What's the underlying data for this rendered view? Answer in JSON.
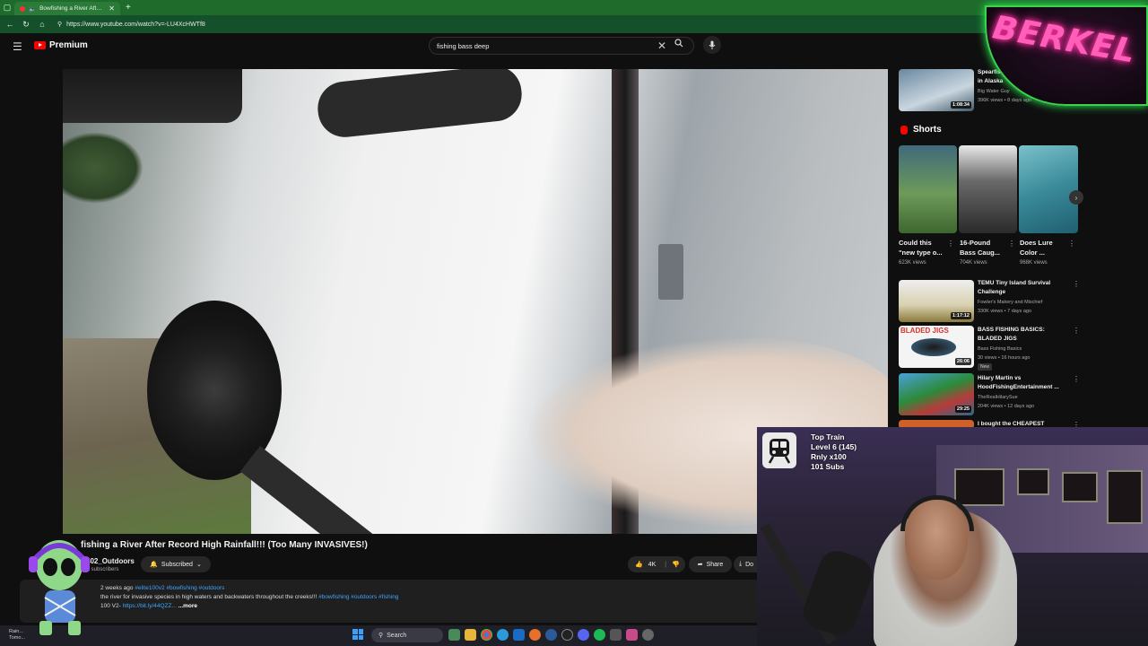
{
  "browser": {
    "tab_title": "Bowfishing a River After Re",
    "url": "https://www.youtube.com/watch?v=-LU4XcHWTf8"
  },
  "header": {
    "logo_label": "Premium",
    "search_query": "fishing bass deep"
  },
  "video": {
    "title": "fishing a River After Record High Rainfall!!! (Too Many INVASIVES!)",
    "channel": "402_Outdoors",
    "subs": "K subscribers",
    "subscribed_label": "Subscribed",
    "likes": "4K",
    "share_label": "Share",
    "download_label": "Do",
    "desc_line1_a": "2 weeks ago",
    "desc_line1_b": "#elite100v2 #bowfishing #outdoors",
    "desc_line2_a": "the river for invasive species in high waters and backwaters throughout the creeks!!!",
    "desc_line2_b": "#bowfishing #outdoors #fishing",
    "desc_line3_a": "100 V2-",
    "desc_line3_b": "https://bit.ly/44QZZ...",
    "more_label": "...more"
  },
  "sidebar": {
    "top_video": {
      "title_l1": "Spearfishing Ha...",
      "title_l2": "in Alaska",
      "channel": "Big Water Guy",
      "meta": "396K views • 8 days ago",
      "duration": "1:08:34"
    },
    "shorts_heading": "Shorts",
    "shorts": [
      {
        "title_l1": "Could this",
        "title_l2": "\"new type o...",
        "views": "623K views"
      },
      {
        "title_l1": "16-Pound",
        "title_l2": "Bass Caug...",
        "views": "704K views"
      },
      {
        "title_l1": "Does Lure",
        "title_l2": "Color ...",
        "views": "968K views"
      }
    ],
    "videos": [
      {
        "title_l1": "TEMU Tiny Island Survival",
        "title_l2": "Challenge",
        "channel": "Fowler's Makery and Mischief",
        "meta": "330K views • 7 days ago",
        "duration": "1:17:12"
      },
      {
        "title_l1": "BASS FISHING BASICS:",
        "title_l2": "BLADED JIGS",
        "channel": "Bass Fishing Basics",
        "meta": "30 views • 16 hours ago",
        "duration": "26:06",
        "badge": "New",
        "thumb_text": "BLADED JIGS"
      },
      {
        "title_l1": "Hilary Martin vs",
        "title_l2": "HoodFishingEntertainment ...",
        "channel": "TheRealHilarySue",
        "meta": "204K views • 12 days ago",
        "duration": "29:25"
      },
      {
        "title_l1": "I bought the CHEAPEST",
        "title_l2": "",
        "channel": "",
        "meta": "",
        "duration": ""
      }
    ]
  },
  "overlay": {
    "neon_text": "BERKEL",
    "train_title": "Top Train",
    "train_level": "Level 6  (145)",
    "train_rnly": "Rnly x100",
    "train_subs": "101 Subs"
  },
  "taskbar": {
    "left_l1": "Rain...",
    "left_l2": "Tomo...",
    "search_label": "Search"
  },
  "colors": {
    "accent_red": "#ff0000",
    "link_blue": "#3ea6ff",
    "neon_pink": "#ff5fb8",
    "neon_green": "#3bd34a",
    "browser_green": "#1e6b2b"
  }
}
